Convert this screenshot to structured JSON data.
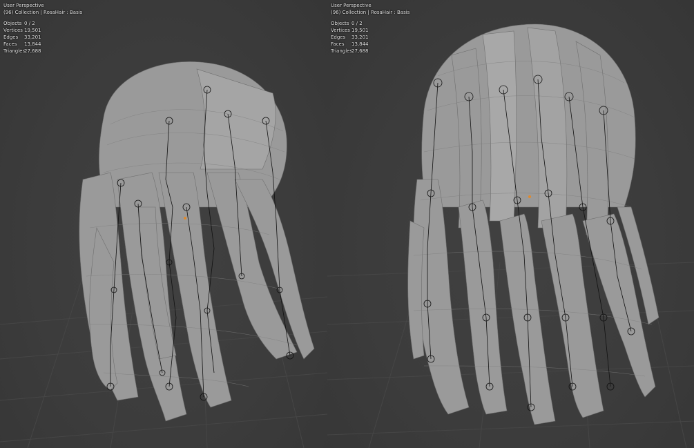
{
  "viewports": [
    {
      "mode": "User Perspective",
      "context": "(96) Collection | RosaHair : Basis",
      "stats": [
        {
          "label": "Objects",
          "value": "0 / 2"
        },
        {
          "label": "Vertices",
          "value": "19,501"
        },
        {
          "label": "Edges",
          "value": "33,201"
        },
        {
          "label": "Faces",
          "value": "13,844"
        },
        {
          "label": "Triangles",
          "value": "27,688"
        }
      ]
    },
    {
      "mode": "User Perspective",
      "context": "(96) Collection | RosaHair : Basis",
      "stats": [
        {
          "label": "Objects",
          "value": "0 / 2"
        },
        {
          "label": "Vertices",
          "value": "19,501"
        },
        {
          "label": "Edges",
          "value": "33,201"
        },
        {
          "label": "Faces",
          "value": "13,844"
        },
        {
          "label": "Triangles",
          "value": "27,688"
        }
      ]
    }
  ],
  "colors": {
    "background": "#3d3d3d",
    "grid": "#474747",
    "hair_mesh": "#9c9c9c",
    "bones": "#111111",
    "origin": "#e08a2c"
  }
}
